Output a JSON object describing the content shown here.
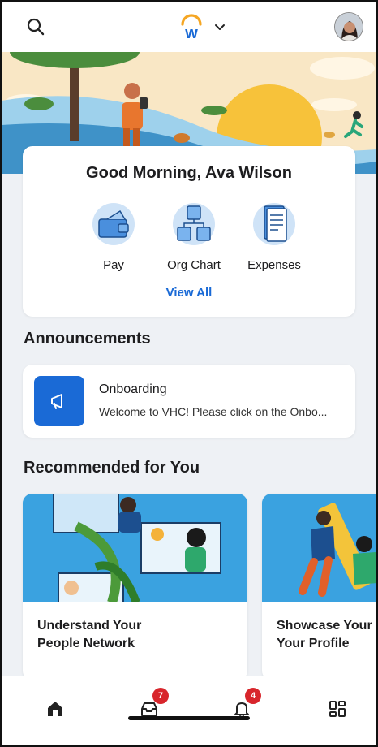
{
  "header": {
    "logo_letter": "w",
    "search_icon": "search-icon",
    "menu_icon": "chevron-down-icon"
  },
  "greeting": {
    "text": "Good Morning, Ava Wilson",
    "quick_actions": [
      {
        "label": "Pay",
        "icon": "wallet-icon"
      },
      {
        "label": "Org Chart",
        "icon": "org-chart-icon"
      },
      {
        "label": "Expenses",
        "icon": "receipt-icon"
      }
    ],
    "view_all_label": "View All"
  },
  "announcements": {
    "section_title": "Announcements",
    "items": [
      {
        "title": "Onboarding",
        "description": "Welcome to VHC! Please click on the Onbo...",
        "icon": "megaphone-icon"
      }
    ]
  },
  "recommended": {
    "section_title": "Recommended for You",
    "items": [
      {
        "title_line1": "Understand Your",
        "title_line2": "People Network"
      },
      {
        "title_line1": "Showcase Your",
        "title_line2": "Your Profile"
      }
    ]
  },
  "bottom_nav": {
    "items": [
      {
        "icon": "home-icon",
        "badge": ""
      },
      {
        "icon": "inbox-icon",
        "badge": "7"
      },
      {
        "icon": "bell-icon",
        "badge": "4"
      },
      {
        "icon": "apps-icon",
        "badge": ""
      }
    ]
  },
  "colors": {
    "accent": "#1a6ad6",
    "badge": "#d8262c",
    "background": "#eef1f5"
  }
}
